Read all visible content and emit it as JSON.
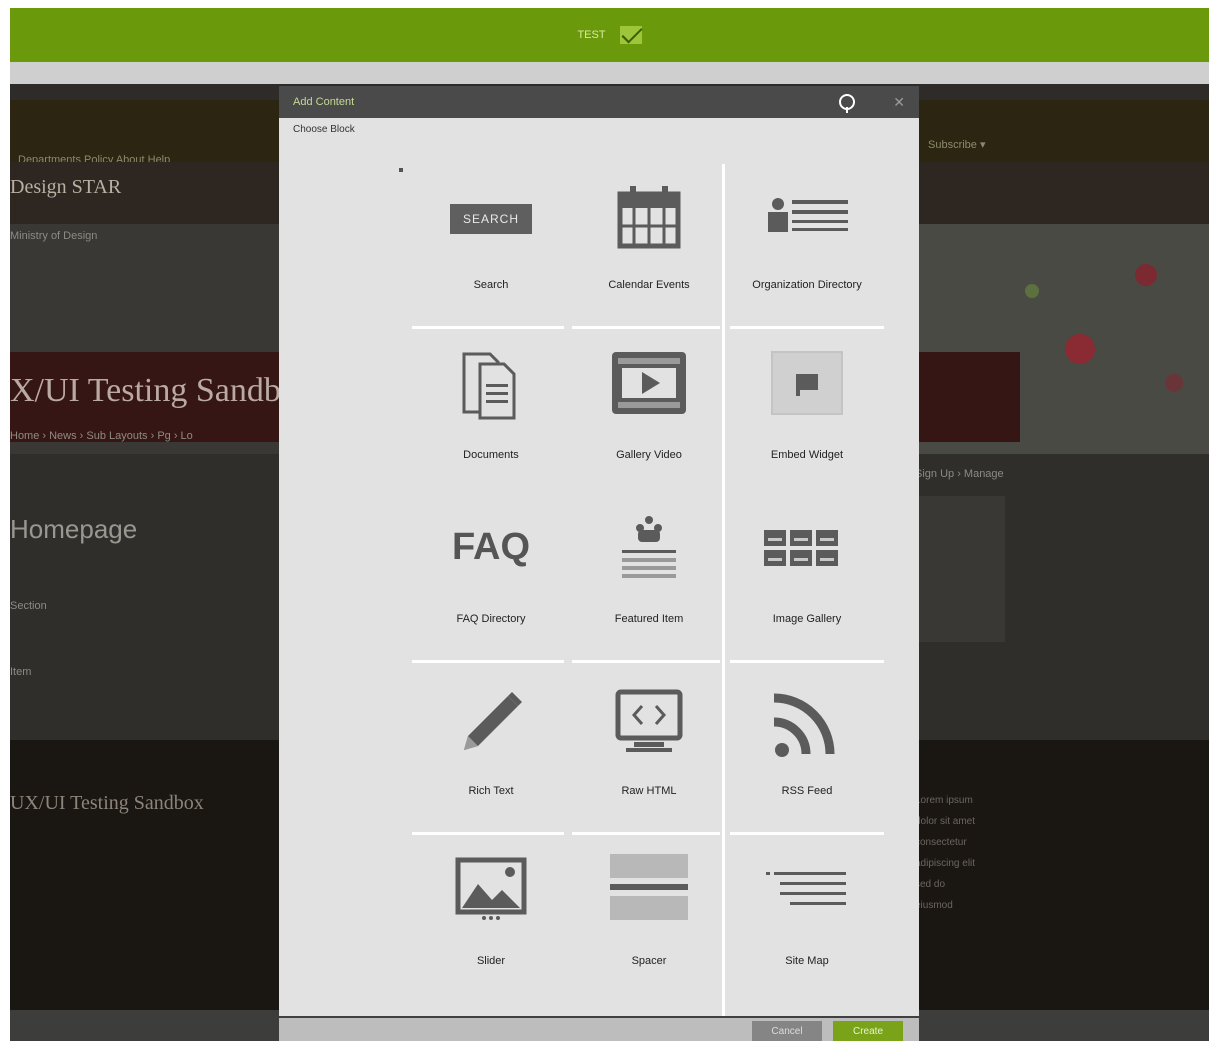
{
  "topbar": {
    "label": "TEST"
  },
  "background": {
    "nav_text": "Departments  Policy  About  Help",
    "nav_right": "Subscribe ▾",
    "brand": "Design STAR",
    "crumb_top": "Ministry of Design",
    "banner_title": "X/UI Testing Sandbox",
    "breadcrumb": "Home › News › Sub Layouts › Pg › Lo",
    "heading": "Homepage",
    "sub1": "Section",
    "sub2": "Item",
    "right_link": "Sign Up › Manage",
    "footer_title": "UX/UI Testing Sandbox",
    "footer_lines": [
      "Lorem ipsum",
      "dolor sit amet",
      "consectetur",
      "adipiscing elit",
      "sed do",
      "eiusmod"
    ]
  },
  "modal": {
    "title": "Add Content",
    "subtitle": "Choose Block",
    "help_icon": "help-circle-icon",
    "close_icon": "close-icon",
    "tiles": [
      {
        "icon": "search-button-icon",
        "button_text": "SEARCH",
        "label": "Search"
      },
      {
        "icon": "calendar-icon",
        "label": "Calendar Events"
      },
      {
        "icon": "organization-directory-icon",
        "label": "Organization Directory"
      },
      {
        "icon": "documents-icon",
        "label": "Documents"
      },
      {
        "icon": "video-icon",
        "label": "Gallery Video"
      },
      {
        "icon": "embed-widget-icon",
        "label": "Embed Widget"
      },
      {
        "icon": "faq-icon",
        "icon_text": "FAQ",
        "label": "FAQ Directory"
      },
      {
        "icon": "featured-item-icon",
        "label": "Featured Item"
      },
      {
        "icon": "image-gallery-icon",
        "label": "Image Gallery"
      },
      {
        "icon": "pencil-icon",
        "label": "Rich Text"
      },
      {
        "icon": "code-monitor-icon",
        "label": "Raw HTML"
      },
      {
        "icon": "rss-icon",
        "label": "RSS Feed"
      },
      {
        "icon": "image-slider-icon",
        "label": "Slider"
      },
      {
        "icon": "spacer-divider-icon",
        "label": "Spacer"
      },
      {
        "icon": "list-lines-icon",
        "label": "Site Map"
      }
    ]
  },
  "footer": {
    "cancel_label": "Cancel",
    "create_label": "Create"
  }
}
